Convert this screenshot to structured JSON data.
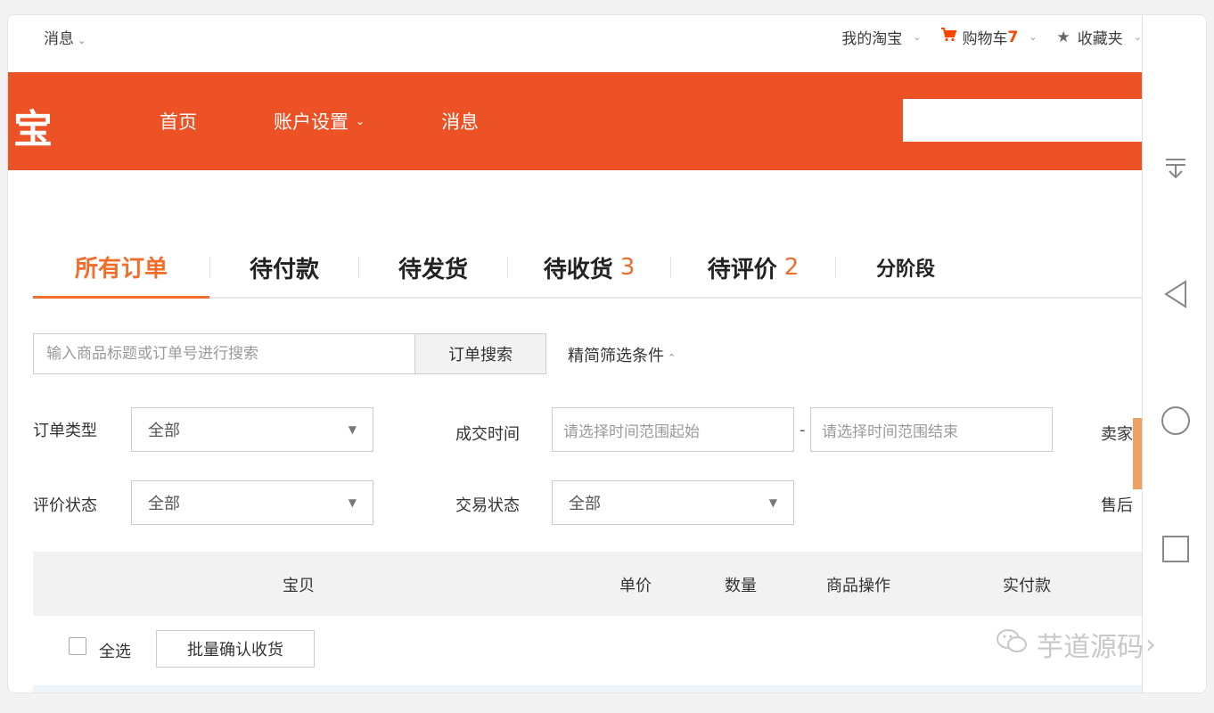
{
  "topbar": {
    "messages": "消息",
    "my_taobao": "我的淘宝",
    "cart_label": "购物车",
    "cart_count": "7",
    "favorites": "收藏夹"
  },
  "header": {
    "logo": "宝",
    "nav": [
      "首页",
      "账户设置",
      "消息"
    ],
    "search_value": ""
  },
  "tabs": [
    {
      "label": "所有订单",
      "badge": ""
    },
    {
      "label": "待付款",
      "badge": ""
    },
    {
      "label": "待发货",
      "badge": ""
    },
    {
      "label": "待收货",
      "badge": "3"
    },
    {
      "label": "待评价",
      "badge": "2"
    },
    {
      "label": "分阶段",
      "badge": ""
    }
  ],
  "search": {
    "placeholder": "输入商品标题或订单号进行搜索",
    "button": "订单搜索",
    "filter_toggle": "精简筛选条件"
  },
  "filters": {
    "order_type_label": "订单类型",
    "order_type_value": "全部",
    "deal_time_label": "成交时间",
    "date_start_placeholder": "请选择时间范围起始",
    "date_sep": "-",
    "date_end_placeholder": "请选择时间范围结束",
    "seller_label": "卖家",
    "review_status_label": "评价状态",
    "review_status_value": "全部",
    "trade_status_label": "交易状态",
    "trade_status_value": "全部",
    "after_sale_label": "售后"
  },
  "table": {
    "columns": [
      "宝贝",
      "单价",
      "数量",
      "商品操作",
      "实付款"
    ]
  },
  "batch": {
    "select_all": "全选",
    "confirm_button": "批量确认收货"
  },
  "watermark": "芋道源码",
  "colors": {
    "brand": "#ec5225",
    "accent": "#f26c2a"
  }
}
